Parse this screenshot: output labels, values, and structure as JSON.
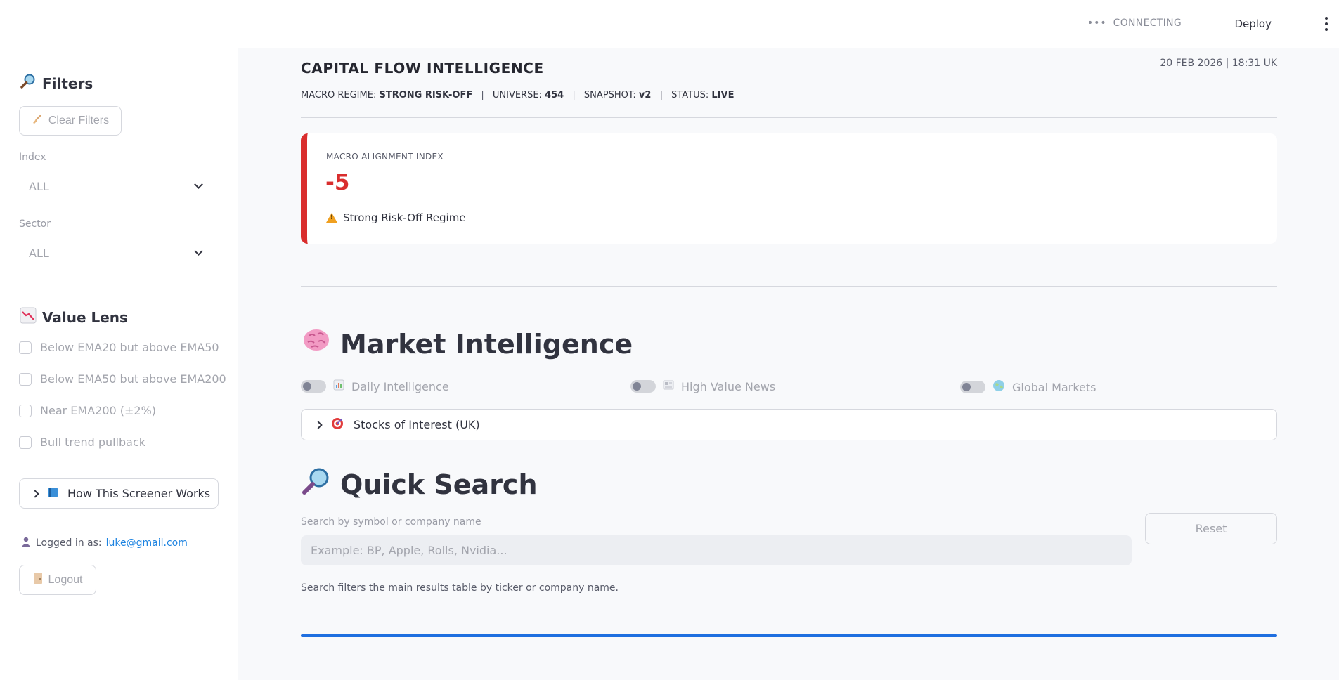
{
  "topbar": {
    "status": "CONNECTING",
    "deploy": "Deploy"
  },
  "sidebar": {
    "filters_heading": "Filters",
    "filters_icon": "magnifier-icon",
    "clear_filters": "Clear Filters",
    "index_label": "Index",
    "index_value": "ALL",
    "sector_label": "Sector",
    "sector_value": "ALL",
    "value_lens_heading": "Value Lens",
    "value_lens_icon": "chart-decreasing-icon",
    "checkboxes": [
      {
        "label": "Below EMA20 but above EMA50",
        "checked": false
      },
      {
        "label": "Below EMA50 but above EMA200",
        "checked": false
      },
      {
        "label": "Near EMA200 (±2%)",
        "checked": false
      },
      {
        "label": "Bull trend pullback",
        "checked": false
      }
    ],
    "how_it_works": "How This Screener Works",
    "logged_in_prefix": "Logged in as:",
    "user_email": "luke@gmail.com",
    "logout": "Logout"
  },
  "header": {
    "title": "CAPITAL FLOW INTELLIGENCE",
    "datetime": "20 FEB 2026 | 18:31 UK",
    "macro_regime_label": "MACRO REGIME:",
    "macro_regime_value": "STRONG RISK-OFF",
    "universe_label": "UNIVERSE:",
    "universe_value": "454",
    "snapshot_label": "SNAPSHOT:",
    "snapshot_value": "v2",
    "status_label": "STATUS:",
    "status_value": "LIVE",
    "separator": "|"
  },
  "macro_card": {
    "label": "MACRO ALIGNMENT INDEX",
    "value": "-5",
    "regime_text": "Strong Risk-Off Regime",
    "accent_color": "#d92d2d"
  },
  "market_intelligence": {
    "heading": "Market Intelligence",
    "icon": "brain-icon",
    "toggles": [
      {
        "label": "Daily Intelligence",
        "icon": "bar-chart-icon",
        "on": false
      },
      {
        "label": "High Value News",
        "icon": "newspaper-icon",
        "on": false
      },
      {
        "label": "Global Markets",
        "icon": "globe-icon",
        "on": false
      }
    ],
    "stocks_of_interest": "Stocks of Interest (UK)"
  },
  "quick_search": {
    "heading": "Quick Search",
    "icon": "magnifier-icon",
    "label": "Search by symbol or company name",
    "placeholder": "Example: BP, Apple, Rolls, Nvidia...",
    "value": "",
    "reset": "Reset",
    "hint": "Search filters the main results table by ticker or company name."
  },
  "progress": {
    "fraction": 1.0,
    "color": "#1f6fe0"
  }
}
